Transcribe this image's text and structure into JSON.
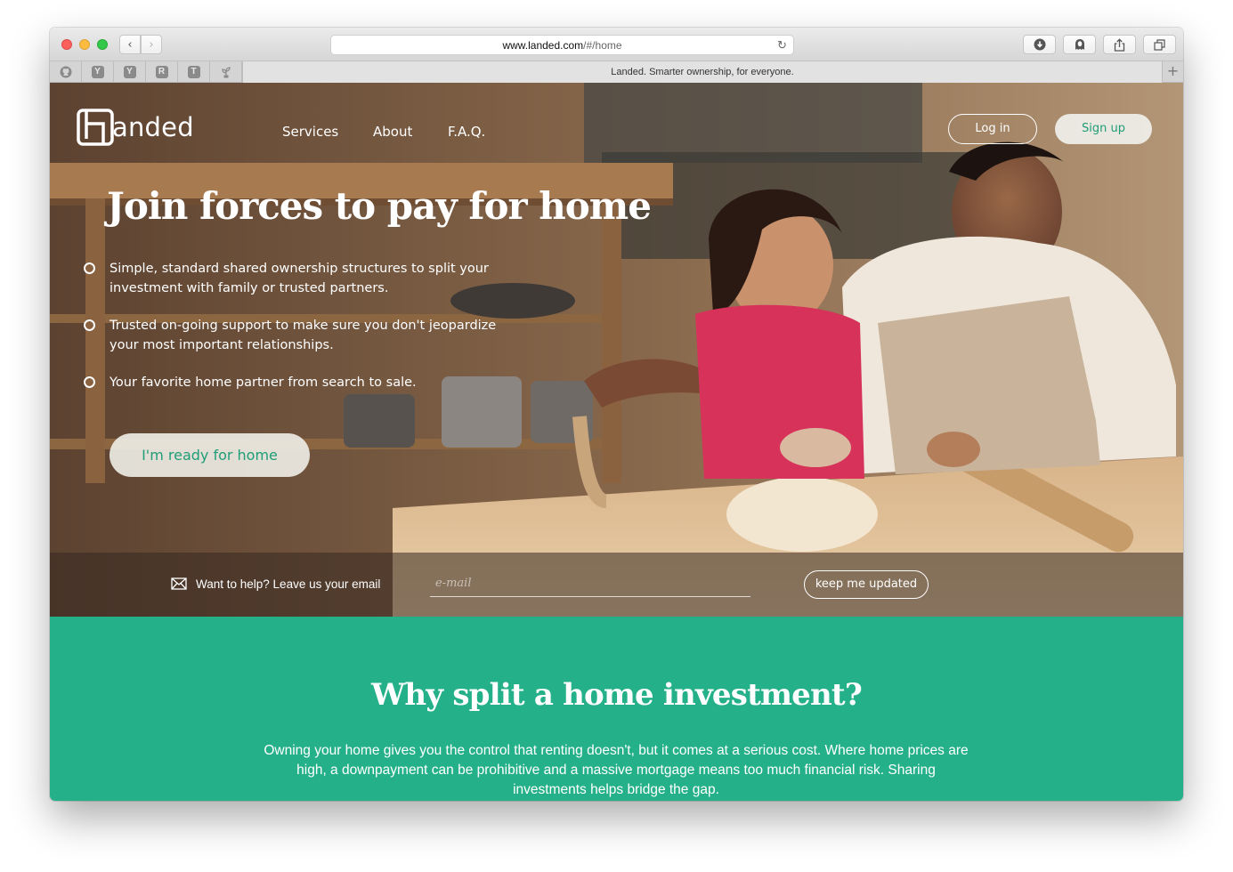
{
  "browser": {
    "url_domain": "www.landed.com",
    "url_path": "/#/home",
    "tab_title": "Landed. Smarter ownership, for everyone.",
    "favorites": [
      "github-icon",
      "Y",
      "Y",
      "R",
      "T",
      "plant-icon"
    ],
    "toolbar_icons": [
      "download-icon",
      "ghostery-icon",
      "share-icon",
      "tabs-icon"
    ]
  },
  "header": {
    "logo_text": "anded",
    "nav": [
      {
        "label": "Services"
      },
      {
        "label": "About"
      },
      {
        "label": "F.A.Q."
      }
    ],
    "login_label": "Log in",
    "signup_label": "Sign up"
  },
  "hero": {
    "headline": "Join forces to pay for home",
    "bullets": [
      "Simple, standard shared ownership structures to split your investment with family or trusted partners.",
      "Trusted on-going support to make sure you don't jeopardize your most important relationships.",
      "Your favorite home partner from search to sale."
    ],
    "cta_label": "I'm ready for home"
  },
  "email_strip": {
    "label": "Want to help? Leave us your email",
    "placeholder": "e-mail",
    "button_label": "keep me updated"
  },
  "why": {
    "title": "Why split a home investment?",
    "body": "Owning your home gives you the control that renting doesn't, but it comes at a serious cost. Where home prices are high, a downpayment can be prohibitive and a massive mortgage means too much financial risk. Sharing investments helps bridge the gap."
  },
  "colors": {
    "brand_green": "#24b088",
    "button_text_green": "#1f9d76"
  }
}
